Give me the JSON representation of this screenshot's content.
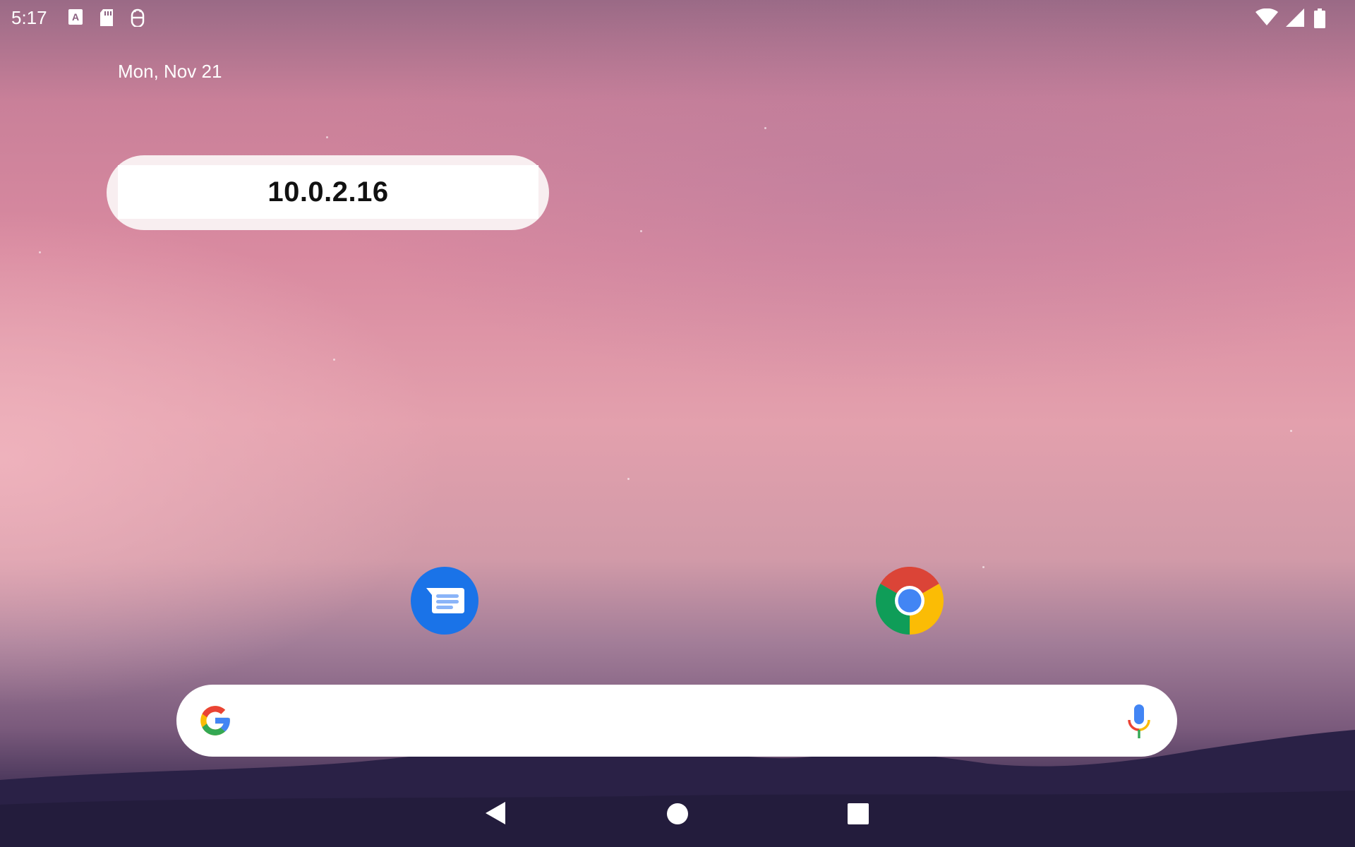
{
  "status_bar": {
    "time": "5:17",
    "left_icons": [
      "font-notification-icon",
      "sd-card-icon",
      "android-debug-icon"
    ],
    "right_icons": [
      "wifi-icon",
      "cell-signal-icon",
      "battery-icon"
    ]
  },
  "home": {
    "date": "Mon, Nov 21",
    "widget": {
      "ip_address": "10.0.2.16"
    },
    "apps": [
      {
        "name": "Messages",
        "icon": "messages-icon"
      },
      {
        "name": "Chrome",
        "icon": "chrome-icon"
      }
    ]
  },
  "search_bar": {
    "value": "",
    "placeholder": "",
    "left_icon": "google-g-icon",
    "right_icon": "microphone-icon"
  },
  "nav_bar": {
    "buttons": [
      "back-icon",
      "home-icon",
      "recents-icon"
    ]
  },
  "colors": {
    "messages_blue": "#1a73e8",
    "google_blue": "#4285f4",
    "google_red": "#ea4335",
    "google_yellow": "#fbbc05",
    "google_green": "#34a853"
  }
}
